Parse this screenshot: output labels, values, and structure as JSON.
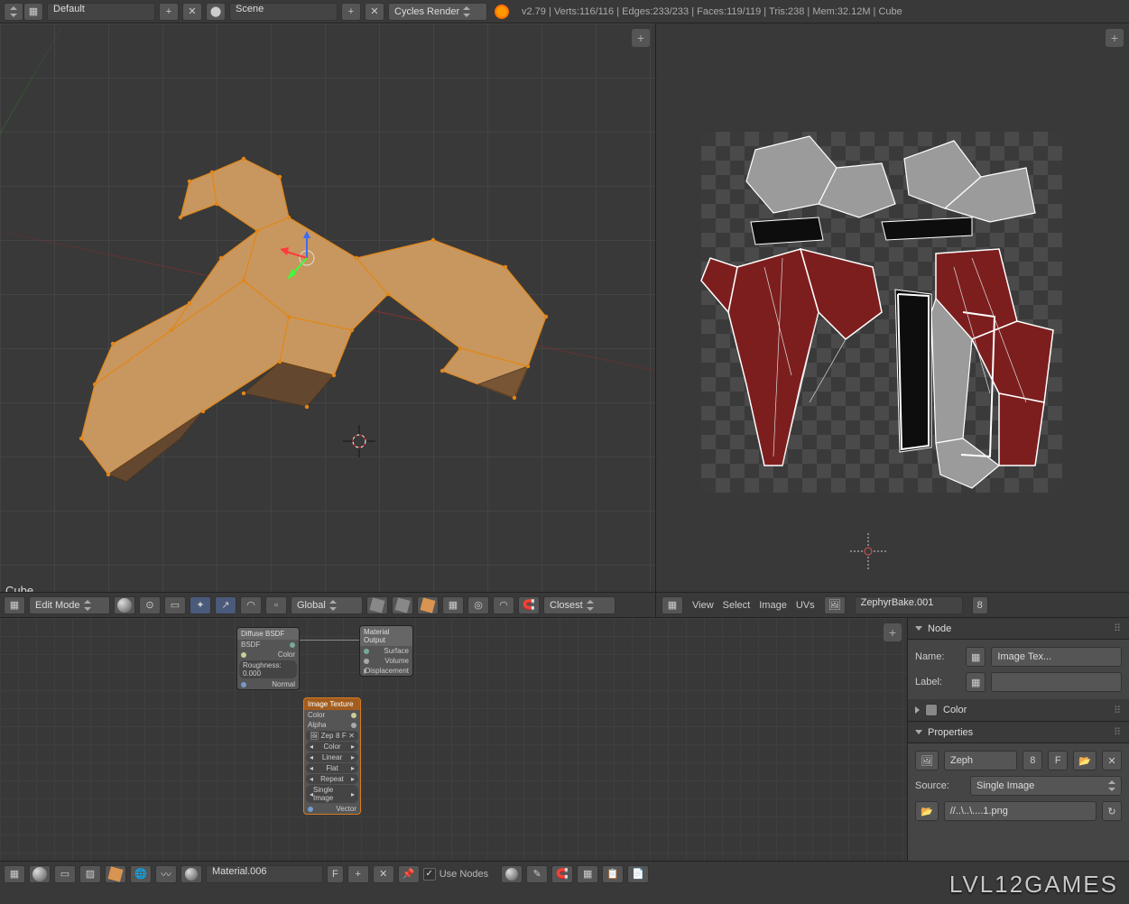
{
  "header": {
    "layout_label": "Default",
    "scene_label": "Scene",
    "renderer_label": "Cycles Render",
    "version": "v2.79",
    "stats": "Verts:116/116 | Edges:233/233 | Faces:119/119 | Tris:238 | Mem:32.12M | Cube"
  },
  "viewport": {
    "object_label": "Cube",
    "mode": "Edit Mode",
    "orientation": "Global",
    "snap": "Closest"
  },
  "uv": {
    "menu_view": "View",
    "menu_select": "Select",
    "menu_image": "Image",
    "menu_uvs": "UVs",
    "image_name": "ZephyrBake.001",
    "image_users": "8"
  },
  "nodes": {
    "diffuse": {
      "title": "Diffuse BSDF",
      "out": "BSDF",
      "color": "Color",
      "rough": "Roughness: 0.000",
      "normal": "Normal"
    },
    "output": {
      "title": "Material Output",
      "surface": "Surface",
      "volume": "Volume",
      "disp": "Displacement"
    },
    "imgtex": {
      "title": "Image Texture",
      "color": "Color",
      "alpha": "Alpha",
      "img": "Zep",
      "cspace": "Color",
      "interp": "Linear",
      "proj": "Flat",
      "ext": "Repeat",
      "src": "Single Image",
      "vector": "Vector"
    }
  },
  "props": {
    "node_hdr": "Node",
    "name_label": "Name:",
    "name_value": "Image Tex...",
    "label_label": "Label:",
    "color_hdr": "Color",
    "props_hdr": "Properties",
    "img_short": "Zeph",
    "users": "8",
    "fake": "F",
    "source_label": "Source:",
    "source_value": "Single Image",
    "filepath": "//..\\..\\....1.png"
  },
  "bottom": {
    "material": "Material.006",
    "fake": "F",
    "use_nodes": "Use Nodes"
  },
  "watermark": "LVL12GAMES"
}
